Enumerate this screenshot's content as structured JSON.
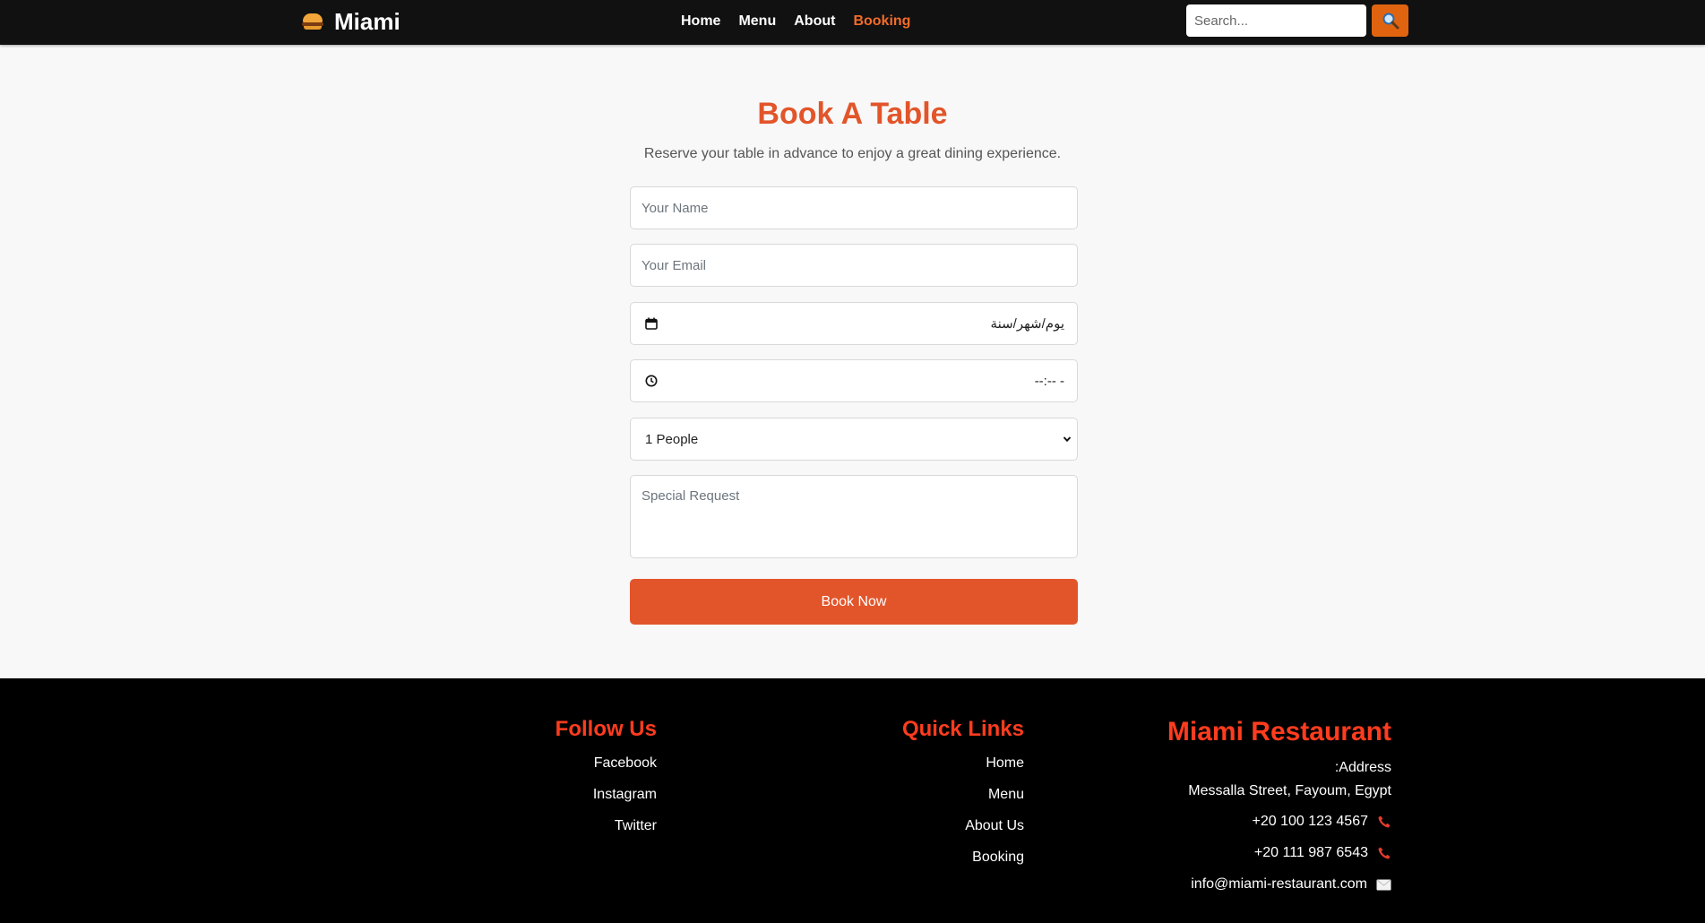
{
  "nav": {
    "brand": "Miami",
    "links": [
      "Home",
      "Menu",
      "About",
      "Booking"
    ],
    "active_link": "Booking",
    "search_placeholder": "Search..."
  },
  "booking": {
    "title": "Book A Table",
    "subtitle": "Reserve your table in advance to enjoy a great dining experience.",
    "name_placeholder": "Your Name",
    "email_placeholder": "Your Email",
    "date_placeholder": "يوم/شهر/سنة",
    "time_placeholder": "--:-- -",
    "people_selected": "1 People",
    "special_placeholder": "Special Request",
    "submit_label": "Book Now"
  },
  "footer": {
    "follow": {
      "title": "Follow Us",
      "links": [
        "Facebook",
        "Instagram",
        "Twitter"
      ]
    },
    "quick": {
      "title": "Quick Links",
      "links": [
        "Home",
        "Menu",
        "About Us",
        "Booking"
      ]
    },
    "info": {
      "title": "Miami Restaurant",
      "address_label": ":Address",
      "address": "Messalla Street, Fayoum, Egypt",
      "phone1": "+20 100 123 4567",
      "phone2": "+20 111 987 6543",
      "email": "info@miami-restaurant.com"
    }
  },
  "colors": {
    "accent": "#e2552a",
    "footer_heading": "#ff3c1e",
    "nav_bg": "#111111",
    "search_btn": "#e0640f"
  },
  "icons": [
    "burger-icon",
    "search-icon",
    "calendar-icon",
    "clock-icon",
    "chevron-down-icon",
    "phone-icon",
    "envelope-icon"
  ]
}
